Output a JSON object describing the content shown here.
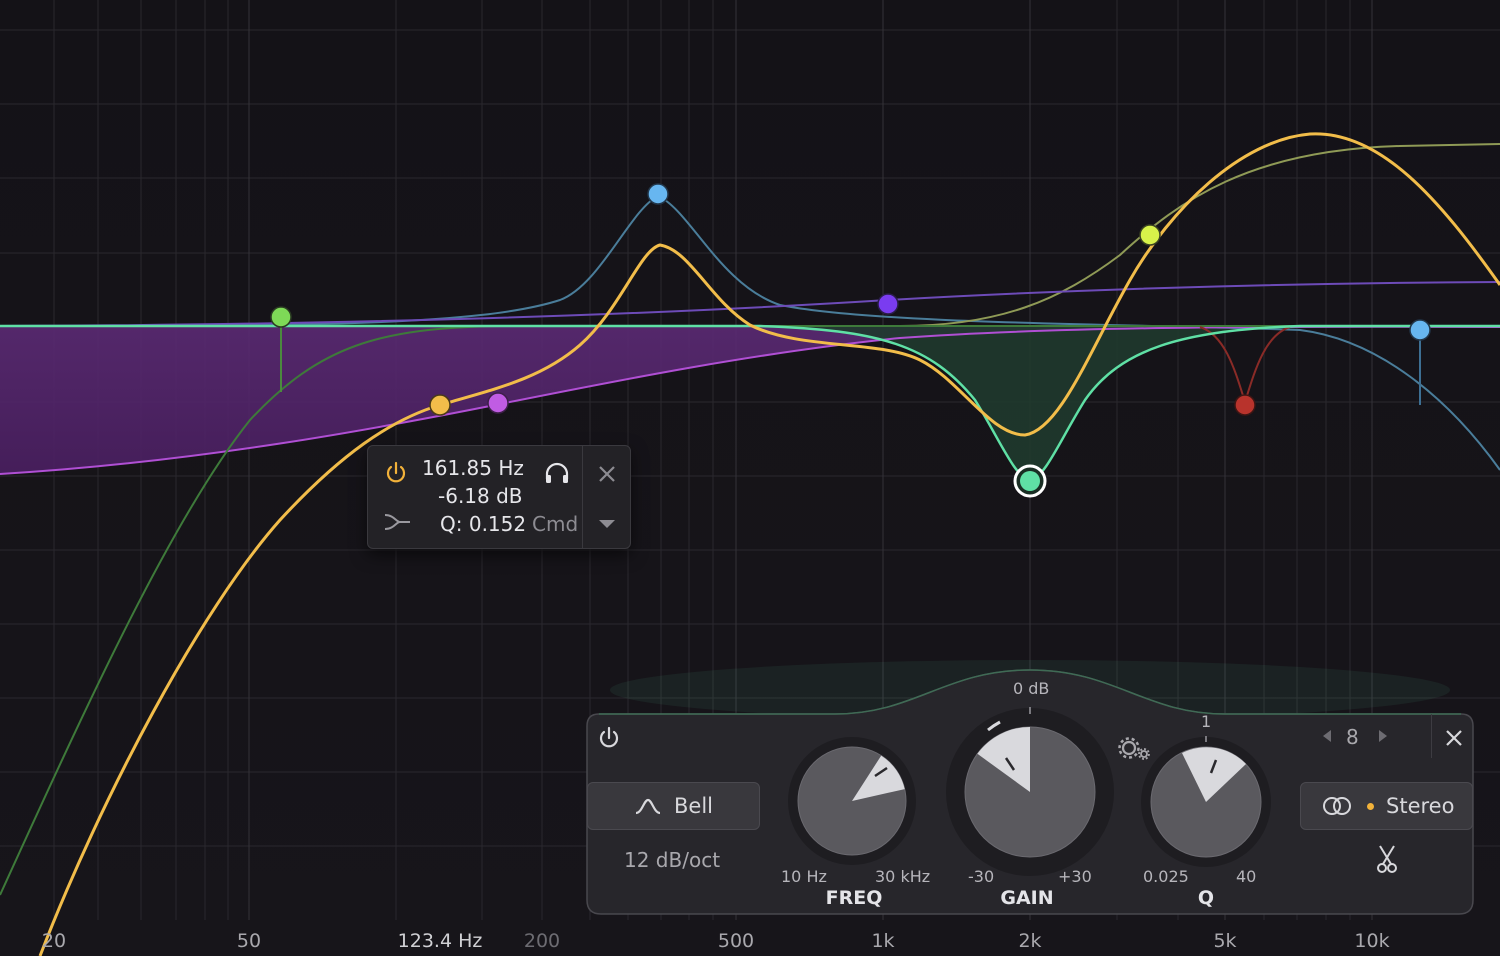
{
  "frequency_axis": {
    "labels": [
      {
        "text": "20"
      },
      {
        "text": "50"
      },
      {
        "text": "123.4 Hz"
      },
      {
        "text": "200"
      },
      {
        "text": "500"
      },
      {
        "text": "1k"
      },
      {
        "text": "2k"
      },
      {
        "text": "5k"
      },
      {
        "text": "10k"
      }
    ]
  },
  "tooltip": {
    "frequency": "161.85 Hz",
    "gain": "-6.18 dB",
    "q": "Q: 0.152",
    "modifier": "Cmd"
  },
  "band_panel": {
    "shape": "Bell",
    "slope": "12 dB/oct",
    "band_number": "8",
    "channel_mode": "Stereo",
    "freq": {
      "title": "FREQ",
      "min": "10 Hz",
      "max": "30 kHz",
      "level": 0.78
    },
    "gain": {
      "title": "GAIN",
      "min": "-30",
      "max": "+30",
      "center": "0 dB",
      "level": 0.4
    },
    "q": {
      "title": "Q",
      "min": "0.025",
      "max": "40",
      "center": "1",
      "level": 0.55
    }
  },
  "colors": {
    "background": "#141217",
    "main_curve": "#f2bd4a",
    "selected_band": "#5fe0a5",
    "purple_band": "#c05ce3",
    "blue_band": "#67b6f0",
    "violet_band": "#7a3cf0",
    "lime_band": "#d8f24a",
    "red_band": "#b8332c",
    "stereo_dot": "#f2b23a"
  },
  "icons": [
    "power-icon",
    "headphones-icon",
    "close-icon",
    "link-icon",
    "dropdown-icon",
    "bell-shape-icon",
    "settings-icon",
    "stereo-icon",
    "scissors-icon",
    "arrow-left-icon",
    "arrow-right-icon"
  ]
}
